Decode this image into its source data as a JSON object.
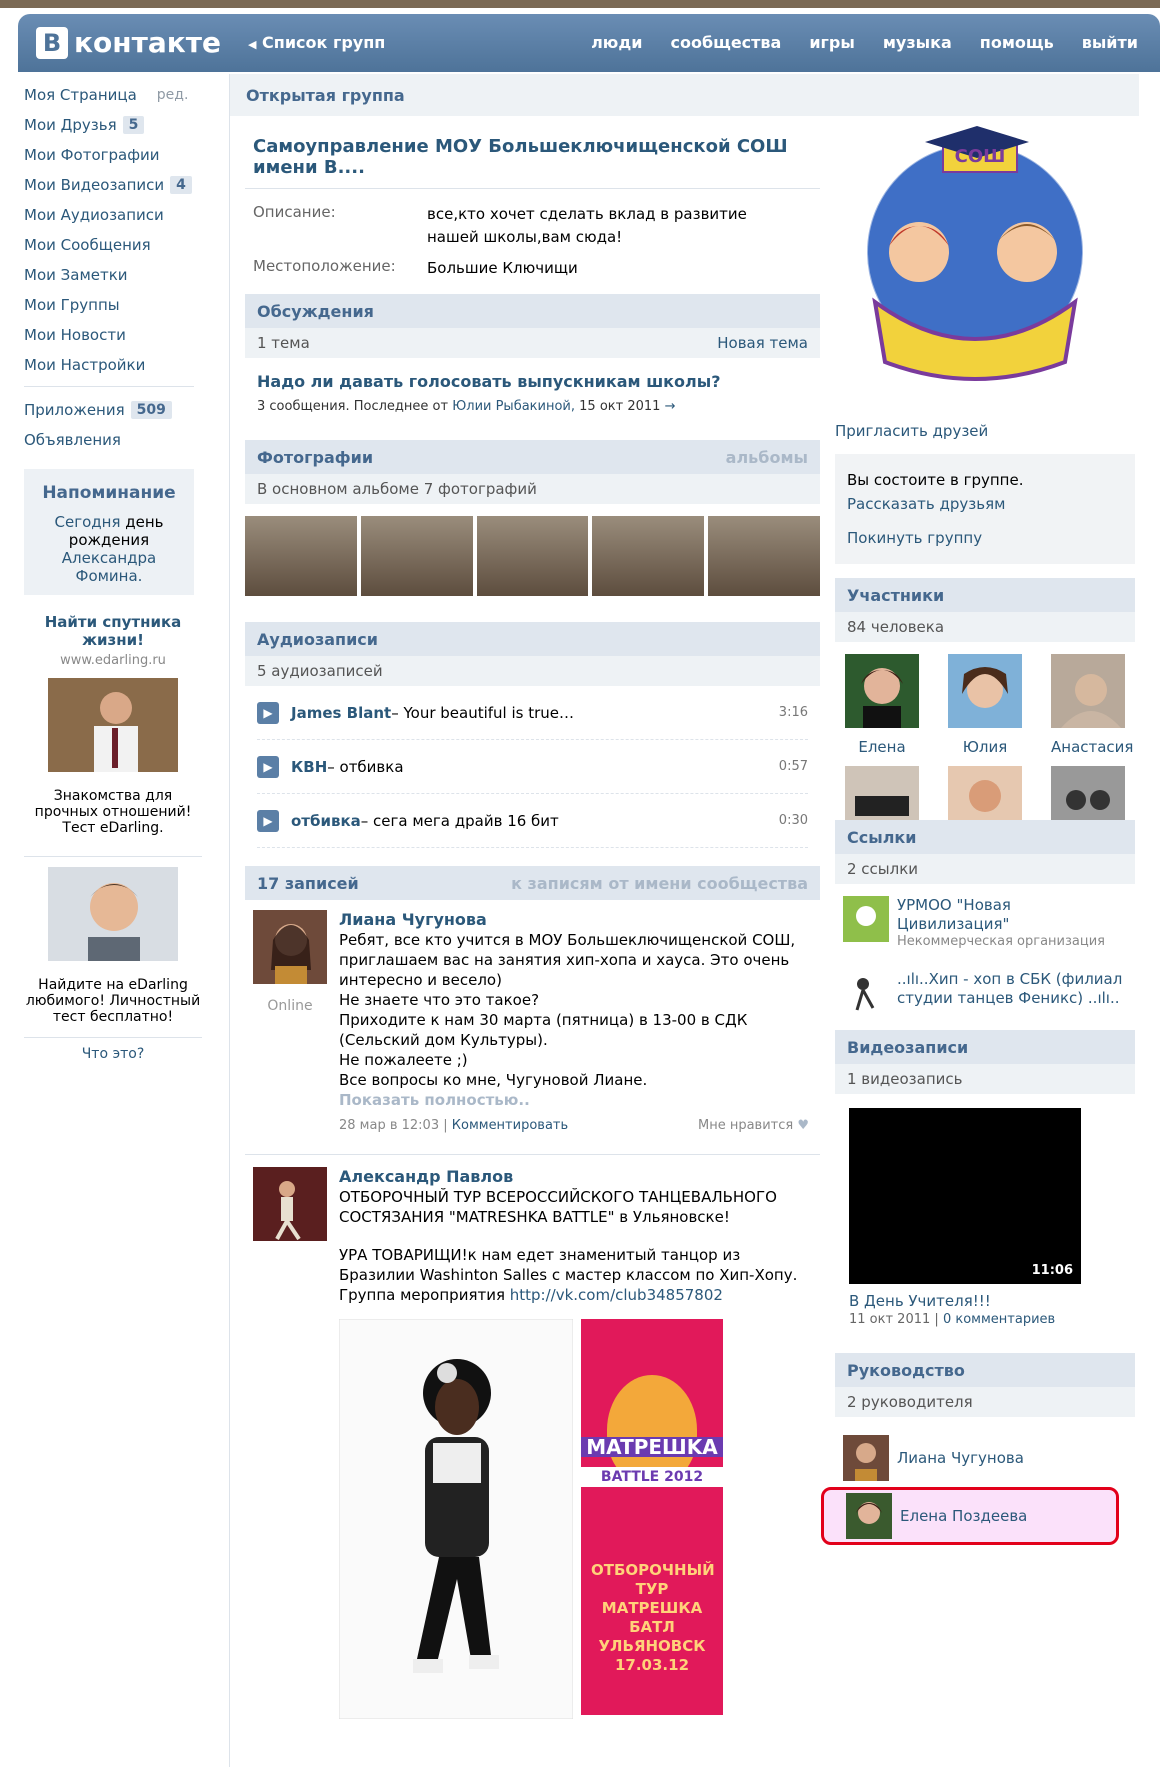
{
  "header": {
    "logo_letter": "В",
    "logo_text": "контакте",
    "back_label": "Список групп",
    "nav": [
      "люди",
      "сообщества",
      "игры",
      "музыка",
      "помощь",
      "выйти"
    ]
  },
  "sidebar": {
    "items": [
      {
        "label": "Моя Страница",
        "extra": "ред."
      },
      {
        "label": "Мои Друзья",
        "count": "5"
      },
      {
        "label": "Мои Фотографии"
      },
      {
        "label": "Мои Видеозаписи",
        "count": "4"
      },
      {
        "label": "Мои Аудиозаписи"
      },
      {
        "label": "Мои Сообщения"
      },
      {
        "label": "Мои Заметки"
      },
      {
        "label": "Мои Группы"
      },
      {
        "label": "Мои Новости"
      },
      {
        "label": "Мои Настройки"
      }
    ],
    "apps": {
      "label": "Приложения",
      "count": "509"
    },
    "ads_label": "Объявления",
    "reminder": {
      "title": "Напоминание",
      "today": "Сегодня",
      "text": "день рождения",
      "name": "Александра Фомина."
    },
    "ad1": {
      "title": "Найти спутника жизни!",
      "domain": "www.edarling.ru",
      "text": "Знакомства для прочных отношений! Тест eDarling."
    },
    "ad2": {
      "text": "Найдите на eDarling любимого! Личностный тест бесплатно!"
    },
    "what_is_this": "Что это?"
  },
  "group": {
    "type": "Открытая группа",
    "title": "Самоуправление МОУ Большеключищенской СОШ имени В....",
    "desc_label": "Описание:",
    "desc": "все,кто хочет сделать вклад в развитие нашей школы,вам сюда!",
    "loc_label": "Местоположение:",
    "loc": "Большие Ключищи"
  },
  "discussions": {
    "title": "Обсуждения",
    "count": "1 тема",
    "new": "Новая тема",
    "topic": "Надо ли давать голосовать выпускникам школы?",
    "meta_prefix": "3 сообщения. Последнее от",
    "meta_author": "Юлии Рыбакиной,",
    "meta_date": "15 окт 2011",
    "arrow": "→"
  },
  "photos": {
    "title": "Фотографии",
    "action": "альбомы",
    "count": "В основном альбоме 7 фотографий"
  },
  "audio": {
    "title": "Аудиозаписи",
    "count": "5 аудиозаписей",
    "tracks": [
      {
        "artist": "James Blant",
        "name": " – Your beautiful is true…",
        "dur": "3:16"
      },
      {
        "artist": "КВН",
        "name": " – отбивка",
        "dur": "0:57"
      },
      {
        "artist": "отбивка",
        "name": " – сега мега драйв 16 бит",
        "dur": "0:30"
      }
    ]
  },
  "wall": {
    "title": "17 записей",
    "action": "к записям от имени сообщества",
    "post1": {
      "author": "Лиана Чугунова",
      "online": "Online",
      "lines": [
        "Ребят, все кто учится в МОУ Большеключищенской СОШ, приглашаем вас на занятия хип-хопа и хауса. Это очень интересно и весело)",
        "Не знаете что это такое?",
        "Приходите к нам 30 марта (пятница) в 13-00 в СДК (Сельский дом Культуры).",
        "Не пожалеете ;)",
        "Все вопросы ко мне, Чугуновой Лиане."
      ],
      "more": "Показать полностью..",
      "date": "28 мар в 12:03",
      "sep": "|",
      "comment": "Комментировать",
      "like": "Мне нравится"
    },
    "post2": {
      "author": "Александр Павлов",
      "line1": "ОТБОРОЧНЫЙ ТУР ВСЕРОССИЙСКОГО ТАНЦЕВАЛЬНОГО СОСТЯЗАНИЯ \"MATRESHKA BATTLE\" в Ульяновске!",
      "line2": "УРА ТОВАРИЩИ!к нам едет знаменитый танцор из Бразилии Washinton Salles с мастер классом по Хип-Хопу.",
      "line3_prefix": "Группа мероприятия",
      "link": "http://vk.com/club34857802",
      "poster_top": "MATPEШKA",
      "poster_mid": "BATTLE 2012",
      "poster_bottom": "ОТБОРОЧНЫЙ ТУР МАТРЕШКА БАТЛ УЛЬЯНОВСК 17.03.12"
    }
  },
  "right": {
    "emblem_text": "СОШ",
    "invite": "Пригласить друзей",
    "member_status": "Вы состоите в группе.",
    "tell": "Рассказать друзьям",
    "leave": "Покинуть группу",
    "members": {
      "title": "Участники",
      "count": "84 человека",
      "names": [
        "Елена",
        "Юлия",
        "Анастасия"
      ]
    },
    "links": {
      "title": "Ссылки",
      "count": "2 ссылки",
      "items": [
        {
          "name": "УРМОО \"Новая Цивилизация\"",
          "org": "Некоммерческая организация"
        },
        {
          "name": "..ılı..Хип - хоп в СБК (филиал студии танцев Феникс) ..ılı.."
        }
      ]
    },
    "videos": {
      "title": "Видеозаписи",
      "count": "1 видеозапись",
      "duration": "11:06",
      "name": "В День Учителя!!!",
      "date": "11 окт 2011",
      "sep": "|",
      "comments": "0 комментариев"
    },
    "leaders": {
      "title": "Руководство",
      "count": "2 руководителя",
      "names": [
        "Лиана Чугунова",
        "Елена Поздеева"
      ]
    }
  },
  "colors": {
    "header": "#5b7fa6",
    "link": "#2b587a",
    "highlight": "#e2001a"
  }
}
